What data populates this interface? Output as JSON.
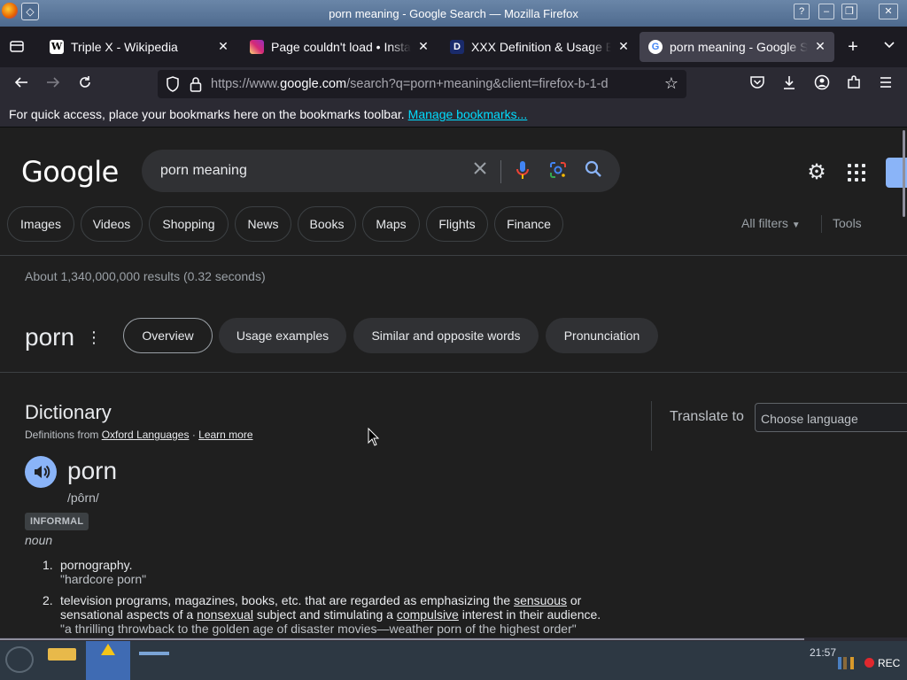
{
  "window": {
    "title": "porn meaning - Google Search — Mozilla Firefox",
    "help_label": "?",
    "pin_glyph": "◇",
    "min_glyph": "–",
    "max_glyph": "❐",
    "close_glyph": "✕"
  },
  "tabs": [
    {
      "label": "Triple X - Wikipedia",
      "favicon": "W",
      "active": false
    },
    {
      "label": "Page couldn't load • Instagram",
      "favicon": "insta",
      "active": false
    },
    {
      "label": "XXX Definition & Usage Examples",
      "favicon": "D",
      "active": false
    },
    {
      "label": "porn meaning - Google Search",
      "favicon": "G",
      "active": true
    }
  ],
  "nav": {
    "url_prefix": "https://www.",
    "url_domain": "google.com",
    "url_rest": "/search?q=porn+meaning&client=firefox-b-1-d"
  },
  "bookmarks_bar": {
    "message": "For quick access, place your bookmarks here on the bookmarks toolbar.",
    "link": "Manage bookmarks..."
  },
  "google": {
    "logo": "Google",
    "query": "porn meaning",
    "filters": [
      "Images",
      "Videos",
      "Shopping",
      "News",
      "Books",
      "Maps",
      "Flights",
      "Finance"
    ],
    "all_filters": "All filters",
    "tools": "Tools",
    "result_stats": "About 1,340,000,000 results (0.32 seconds)"
  },
  "word_panel": {
    "word": "porn",
    "tabs": [
      "Overview",
      "Usage examples",
      "Similar and opposite words",
      "Pronunciation"
    ],
    "selected_tab": "Overview"
  },
  "dictionary": {
    "title": "Dictionary",
    "definitions_from": "Definitions from",
    "source": "Oxford Languages",
    "separator": "·",
    "learn_more": "Learn more",
    "translate_to": "Translate to",
    "choose_language": "Choose language",
    "headword": "porn",
    "phonetic": "/pôrn/",
    "register": "INFORMAL",
    "part_of_speech": "noun",
    "definitions": [
      {
        "num": "1.",
        "text_parts": [
          "pornography."
        ],
        "example": "\"hardcore porn\""
      },
      {
        "num": "2.",
        "text_a": "television programs, magazines, books, etc. that are regarded as emphasizing the ",
        "link1": "sensuous",
        "text_b": " or sensational aspects of a ",
        "link2": "nonsexual",
        "text_c": " subject and stimulating a ",
        "link3": "compulsive",
        "text_d": " interest in their audience.",
        "example": "\"a thrilling throwback to the golden age of disaster movies—weather porn of the highest order\""
      }
    ]
  },
  "taskbar": {
    "clock": "21:57",
    "rec": "REC"
  }
}
